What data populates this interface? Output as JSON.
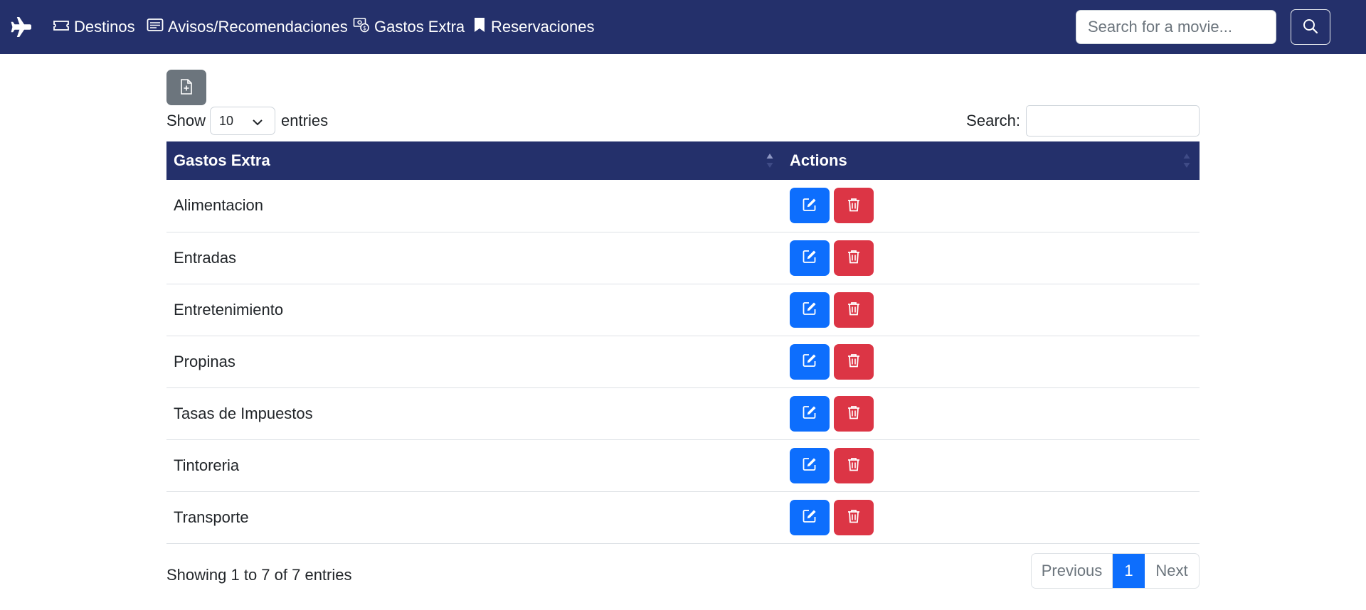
{
  "navbar": {
    "brand_icon": "plane-icon",
    "links": [
      {
        "label": "Destinos",
        "icon": "ticket-icon"
      },
      {
        "label": "Avisos/Recomendaciones",
        "icon": "card-text-icon"
      },
      {
        "label": "Gastos Extra",
        "icon": "cash-coin-icon"
      },
      {
        "label": "Reservaciones",
        "icon": "bookmark-icon"
      }
    ],
    "search_placeholder": "Search for a movie...",
    "search_button_icon": "search-icon"
  },
  "toolbar": {
    "add_icon": "file-plus-icon"
  },
  "length": {
    "show_label": "Show",
    "selected": "10",
    "entries_label": "entries"
  },
  "filter": {
    "label": "Search:",
    "value": ""
  },
  "table": {
    "headers": [
      "Gastos Extra",
      "Actions"
    ],
    "rows": [
      {
        "name": "Alimentacion"
      },
      {
        "name": "Entradas"
      },
      {
        "name": "Entretenimiento"
      },
      {
        "name": "Propinas"
      },
      {
        "name": "Tasas de Impuestos"
      },
      {
        "name": "Tintoreria"
      },
      {
        "name": "Transporte"
      }
    ]
  },
  "info": "Showing 1 to 7 of 7 entries",
  "pagination": {
    "previous": "Previous",
    "current": "1",
    "next": "Next"
  },
  "colors": {
    "navbar": "#24306b",
    "primary": "#0d6efd",
    "danger": "#dc3545",
    "secondary": "#6c757d"
  }
}
